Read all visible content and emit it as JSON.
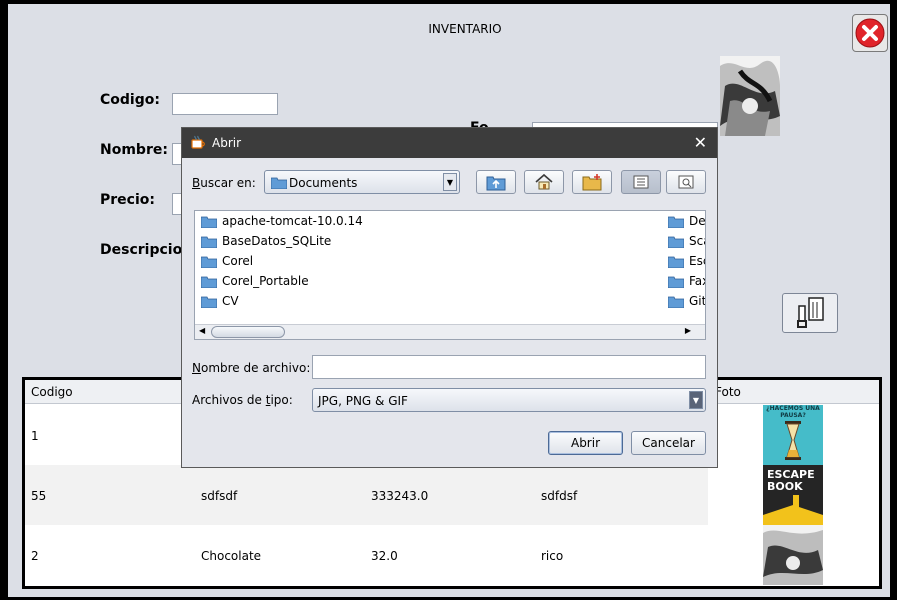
{
  "window": {
    "title": "INVENTARIO"
  },
  "form": {
    "codigo_label": "Codigo:",
    "nombre_label": "Nombre:",
    "precio_label": "Precio:",
    "descripcion_label": "Descripcion:",
    "partial_label": "Fo"
  },
  "table": {
    "headers": [
      "Codigo",
      "Foto"
    ],
    "rows": [
      {
        "codigo": "1",
        "nombre": "",
        "precio": "",
        "descripcion": "",
        "foto": "book-cover-hourglass",
        "foto_text": "¿HACEMOS UNA PAUSA?"
      },
      {
        "codigo": "55",
        "nombre": "sdfsdf",
        "precio": "333243.0",
        "descripcion": "sdfdsf",
        "foto": "book-cover-escape",
        "foto_text": "ESCAPE BOOK"
      },
      {
        "codigo": "2",
        "nombre": "Chocolate",
        "precio": "32.0",
        "descripcion": "rico",
        "foto": "photo-grayscale"
      }
    ]
  },
  "dialog": {
    "title": "Abrir",
    "look_in_label": "Buscar en:",
    "look_in_underline": "B",
    "look_in_rest": "uscar en:",
    "look_in_value": "Documents",
    "files_left": [
      "apache-tomcat-10.0.14",
      "BaseDatos_SQLite",
      "Corel",
      "Corel_Portable",
      "CV"
    ],
    "files_right": [
      "De",
      "Sca",
      "Esc",
      "Fax",
      "Git"
    ],
    "filename_label_u": "N",
    "filename_label_rest": "ombre de archivo:",
    "filename_value": "",
    "filetype_label_pre": "Archivos de ",
    "filetype_label_u": "t",
    "filetype_label_rest": "ipo:",
    "filetype_value": "JPG, PNG & GIF",
    "open_button": "Abrir",
    "cancel_button": "Cancelar"
  },
  "colors": {
    "background": "#dcdfe6",
    "close_icon": "#e0242a",
    "folder": "#5f9bd6"
  }
}
